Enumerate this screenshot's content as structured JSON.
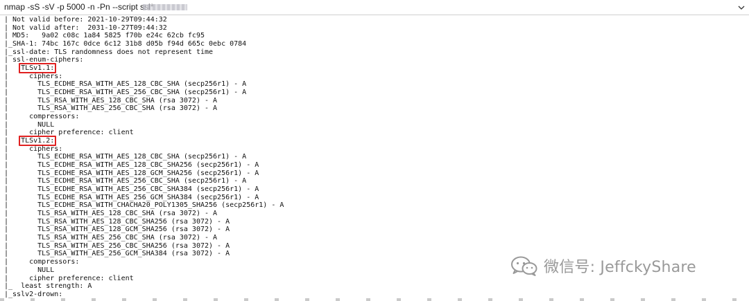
{
  "command_bar": {
    "command": "nmap -sS -sV -p 5000 -n -Pn --script ssl*",
    "dropdown_icon": "chevron-down-icon"
  },
  "output_lines": [
    "| Not valid before: 2021-10-29T09:44:32",
    "| Not valid after:  2031-10-27T09:44:32",
    "| MD5:   9a02 c08c 1a84 5825 f70b e24c 62cb fc95",
    "|_SHA-1: 74bc 167c 0dce 6c12 31b8 d05b f94d 665c 0ebc 0784",
    "|_ssl-date: TLS randomness does not represent time",
    "| ssl-enum-ciphers:",
    "|   ",
    "|     ciphers:",
    "|       TLS_ECDHE_RSA_WITH_AES_128_CBC_SHA (secp256r1) - A",
    "|       TLS_ECDHE_RSA_WITH_AES_256_CBC_SHA (secp256r1) - A",
    "|       TLS_RSA_WITH_AES_128_CBC_SHA (rsa 3072) - A",
    "|       TLS_RSA_WITH_AES_256_CBC_SHA (rsa 3072) - A",
    "|     compressors:",
    "|       NULL",
    "|     cipher preference: client",
    "|   ",
    "|     ciphers:",
    "|       TLS_ECDHE_RSA_WITH_AES_128_CBC_SHA (secp256r1) - A",
    "|       TLS_ECDHE_RSA_WITH_AES_128_CBC_SHA256 (secp256r1) - A",
    "|       TLS_ECDHE_RSA_WITH_AES_128_GCM_SHA256 (secp256r1) - A",
    "|       TLS_ECDHE_RSA_WITH_AES_256_CBC_SHA (secp256r1) - A",
    "|       TLS_ECDHE_RSA_WITH_AES_256_CBC_SHA384 (secp256r1) - A",
    "|       TLS_ECDHE_RSA_WITH_AES_256_GCM_SHA384 (secp256r1) - A",
    "|       TLS_ECDHE_RSA_WITH_CHACHA20_POLY1305_SHA256 (secp256r1) - A",
    "|       TLS_RSA_WITH_AES_128_CBC_SHA (rsa 3072) - A",
    "|       TLS_RSA_WITH_AES_128_CBC_SHA256 (rsa 3072) - A",
    "|       TLS_RSA_WITH_AES_128_GCM_SHA256 (rsa 3072) - A",
    "|       TLS_RSA_WITH_AES_256_CBC_SHA (rsa 3072) - A",
    "|       TLS_RSA_WITH_AES_256_CBC_SHA256 (rsa 3072) - A",
    "|       TLS_RSA_WITH_AES_256_GCM_SHA384 (rsa 3072) - A",
    "|     compressors:",
    "|       NULL",
    "|     cipher preference: client",
    "|_  least strength: A",
    "|_sslv2-drown:"
  ],
  "highlights": {
    "tls11": "TLSv1.1:",
    "tls12": "TLSv1.2:",
    "color": "#e02020"
  },
  "watermark": {
    "icon": "wechat-icon",
    "text": "微信号: JeffckyShare"
  }
}
